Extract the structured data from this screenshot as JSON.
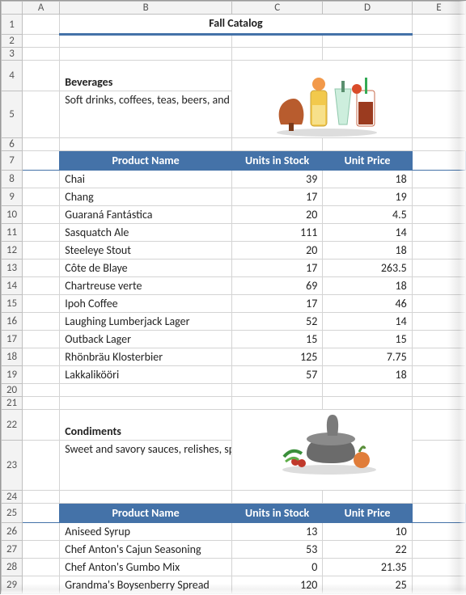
{
  "columns": [
    "A",
    "B",
    "C",
    "D",
    "E"
  ],
  "rowNumbers": [
    1,
    2,
    3,
    4,
    5,
    6,
    7,
    8,
    9,
    10,
    11,
    12,
    13,
    14,
    15,
    16,
    17,
    18,
    19,
    20,
    21,
    22,
    23,
    24,
    25,
    26,
    27,
    28,
    29
  ],
  "title": "Fall Catalog",
  "headers": {
    "product": "Product Name",
    "units": "Units in Stock",
    "price": "Unit Price"
  },
  "sections": [
    {
      "name": "Beverages",
      "desc": "Soft drinks, coffees, teas, beers, and ales",
      "rows": [
        {
          "name": "Chai",
          "units": 39,
          "price": 18
        },
        {
          "name": "Chang",
          "units": 17,
          "price": 19
        },
        {
          "name": "Guaraná Fantástica",
          "units": 20,
          "price": 4.5
        },
        {
          "name": "Sasquatch Ale",
          "units": 111,
          "price": 14
        },
        {
          "name": "Steeleye Stout",
          "units": 20,
          "price": 18
        },
        {
          "name": "Côte de Blaye",
          "units": 17,
          "price": 263.5
        },
        {
          "name": "Chartreuse verte",
          "units": 69,
          "price": 18
        },
        {
          "name": "Ipoh Coffee",
          "units": 17,
          "price": 46
        },
        {
          "name": "Laughing Lumberjack Lager",
          "units": 52,
          "price": 14
        },
        {
          "name": "Outback Lager",
          "units": 15,
          "price": 15
        },
        {
          "name": "Rhönbräu Klosterbier",
          "units": 125,
          "price": 7.75
        },
        {
          "name": "Lakkalikööri",
          "units": 57,
          "price": 18
        }
      ]
    },
    {
      "name": "Condiments",
      "desc": "Sweet and savory sauces, relishes, spreads, and seasonings",
      "rows": [
        {
          "name": "Aniseed Syrup",
          "units": 13,
          "price": 10
        },
        {
          "name": "Chef Anton's Cajun Seasoning",
          "units": 53,
          "price": 22
        },
        {
          "name": "Chef Anton's Gumbo Mix",
          "units": 0,
          "price": 21.35
        },
        {
          "name": "Grandma's Boysenberry Spread",
          "units": 120,
          "price": 25
        }
      ]
    }
  ],
  "chart_data": {
    "type": "table",
    "title": "Fall Catalog",
    "tables": [
      {
        "category": "Beverages",
        "columns": [
          "Product Name",
          "Units in Stock",
          "Unit Price"
        ],
        "rows": [
          [
            "Chai",
            39,
            18
          ],
          [
            "Chang",
            17,
            19
          ],
          [
            "Guaraná Fantástica",
            20,
            4.5
          ],
          [
            "Sasquatch Ale",
            111,
            14
          ],
          [
            "Steeleye Stout",
            20,
            18
          ],
          [
            "Côte de Blaye",
            17,
            263.5
          ],
          [
            "Chartreuse verte",
            69,
            18
          ],
          [
            "Ipoh Coffee",
            17,
            46
          ],
          [
            "Laughing Lumberjack Lager",
            52,
            14
          ],
          [
            "Outback Lager",
            15,
            15
          ],
          [
            "Rhönbräu Klosterbier",
            125,
            7.75
          ],
          [
            "Lakkalikööri",
            57,
            18
          ]
        ]
      },
      {
        "category": "Condiments",
        "columns": [
          "Product Name",
          "Units in Stock",
          "Unit Price"
        ],
        "rows": [
          [
            "Aniseed Syrup",
            13,
            10
          ],
          [
            "Chef Anton's Cajun Seasoning",
            53,
            22
          ],
          [
            "Chef Anton's Gumbo Mix",
            0,
            21.35
          ],
          [
            "Grandma's Boysenberry Spread",
            120,
            25
          ]
        ]
      }
    ]
  }
}
